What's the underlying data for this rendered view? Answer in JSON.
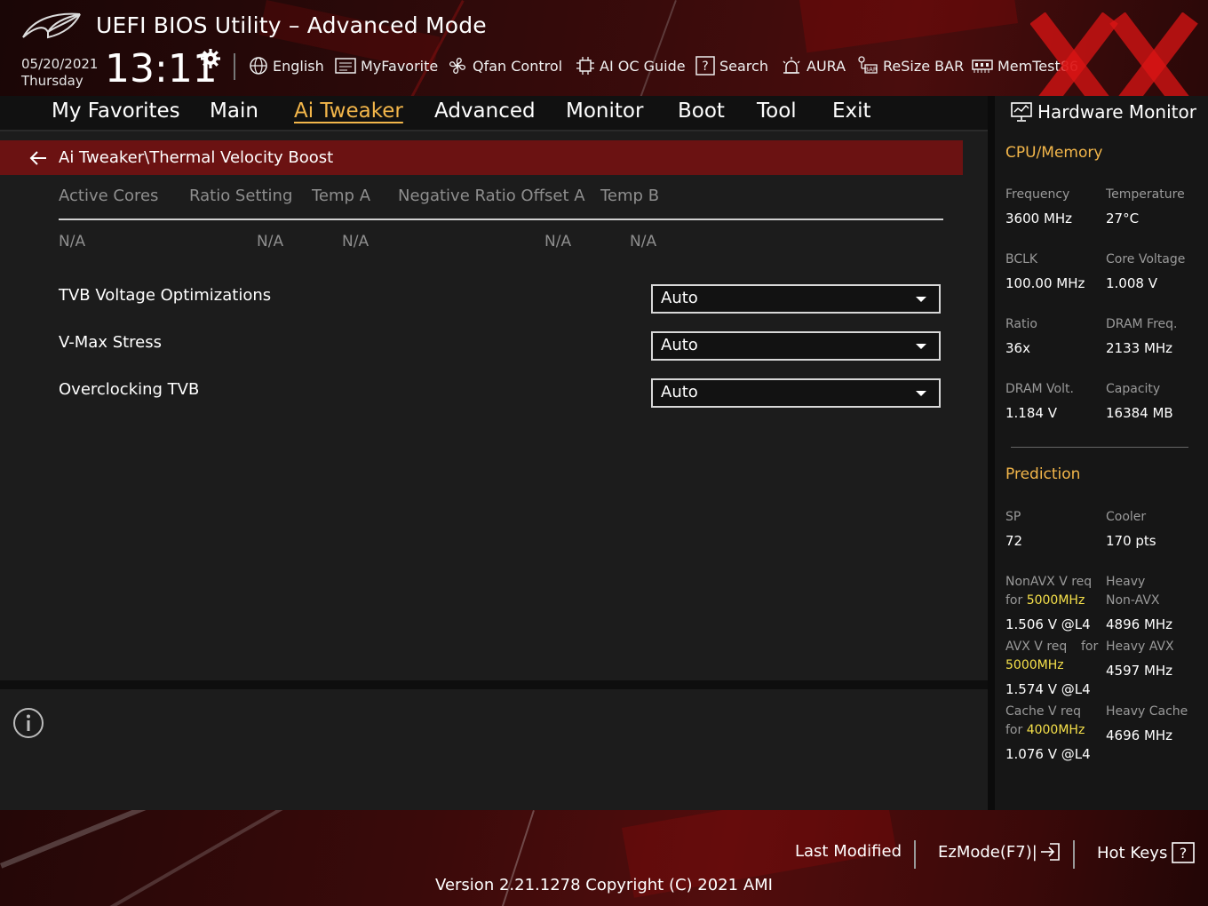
{
  "header": {
    "title": "UEFI BIOS Utility – Advanced Mode",
    "date": "05/20/2021",
    "weekday": "Thursday",
    "time": "13:11",
    "tools": [
      {
        "label": "English",
        "icon": "globe-icon"
      },
      {
        "label": "MyFavorite",
        "icon": "favorite-list-icon"
      },
      {
        "label": "Qfan Control",
        "icon": "fan-icon"
      },
      {
        "label": "AI OC Guide",
        "icon": "chip-icon"
      },
      {
        "label": "Search",
        "icon": "question-box-icon"
      },
      {
        "label": "AURA",
        "icon": "aura-light-icon"
      },
      {
        "label": "ReSize BAR",
        "icon": "resize-bar-icon"
      },
      {
        "label": "MemTest86",
        "icon": "memory-icon"
      }
    ]
  },
  "nav": {
    "tabs": [
      "My Favorites",
      "Main",
      "Ai Tweaker",
      "Advanced",
      "Monitor",
      "Boot",
      "Tool",
      "Exit"
    ],
    "active": "Ai Tweaker"
  },
  "breadcrumb": "Ai Tweaker\\Thermal Velocity Boost",
  "table": {
    "headers": [
      "Active Cores",
      "Ratio Setting",
      "Temp A",
      "Negative Ratio Offset A",
      "Temp B"
    ],
    "row": [
      "N/A",
      "N/A",
      "N/A",
      "N/A",
      "N/A"
    ]
  },
  "options": [
    {
      "label": "TVB Voltage Optimizations",
      "value": "Auto"
    },
    {
      "label": "V-Max Stress",
      "value": "Auto"
    },
    {
      "label": "Overclocking TVB",
      "value": "Auto"
    }
  ],
  "hw_monitor": {
    "title": "Hardware Monitor",
    "cpu_memory": {
      "section": "CPU/Memory",
      "items": [
        {
          "label": "Frequency",
          "value": "3600 MHz"
        },
        {
          "label": "Temperature",
          "value": "27°C"
        },
        {
          "label": "BCLK",
          "value": "100.00 MHz"
        },
        {
          "label": "Core Voltage",
          "value": "1.008 V"
        },
        {
          "label": "Ratio",
          "value": "36x"
        },
        {
          "label": "DRAM Freq.",
          "value": "2133 MHz"
        },
        {
          "label": "DRAM Volt.",
          "value": "1.184 V"
        },
        {
          "label": "Capacity",
          "value": "16384 MB"
        }
      ]
    },
    "prediction": {
      "section": "Prediction",
      "sp_label": "SP",
      "sp_value": "72",
      "cooler_label": "Cooler",
      "cooler_value": "170 pts",
      "nonavx_label_1": "NonAVX V req",
      "nonavx_label_2": "for",
      "nonavx_freq": "5000MHz",
      "nonavx_value": "1.506 V @L4",
      "heavy_nonavx_label_1": "Heavy",
      "heavy_nonavx_label_2": "Non-AVX",
      "heavy_nonavx_value": "4896 MHz",
      "avx_label_1": "AVX V req",
      "avx_label_2": "for",
      "avx_freq": "5000MHz",
      "avx_value": "1.574 V @L4",
      "heavy_avx_label": "Heavy AVX",
      "heavy_avx_value": "4597 MHz",
      "cache_label_1": "Cache V req",
      "cache_label_2": "for",
      "cache_freq": "4000MHz",
      "cache_value": "1.076 V @L4",
      "heavy_cache_label": "Heavy Cache",
      "heavy_cache_value": "4696 MHz"
    }
  },
  "footer": {
    "last_modified": "Last Modified",
    "ezmode": "EzMode(F7)|",
    "hot_keys": "Hot Keys",
    "version": "Version 2.21.1278 Copyright (C) 2021 AMI"
  },
  "colors": {
    "accent": "#f3b64a",
    "highlight": "#f5e04a",
    "breadcrumb_bg": "#6b1212"
  }
}
